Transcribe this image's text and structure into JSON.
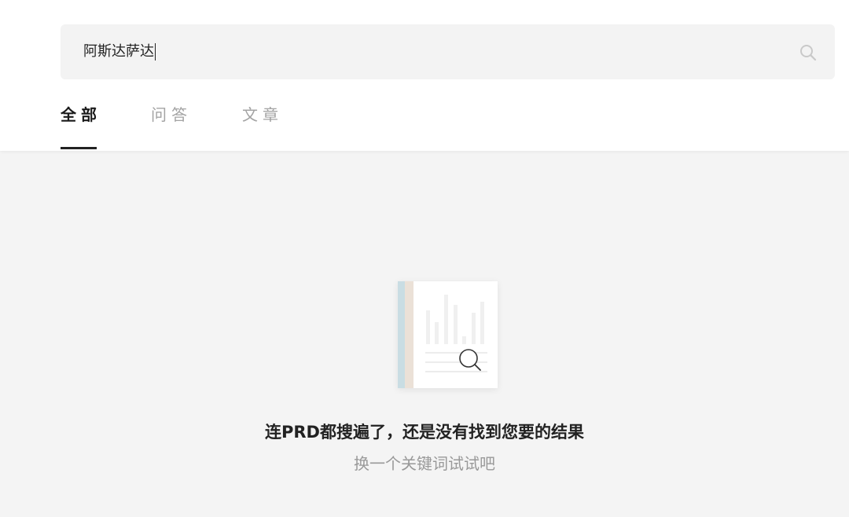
{
  "search": {
    "query": "阿斯达萨达",
    "icon": "search-icon"
  },
  "tabs": [
    {
      "label": "全部",
      "active": true
    },
    {
      "label": "问答",
      "active": false
    },
    {
      "label": "文章",
      "active": false
    }
  ],
  "empty_state": {
    "title": "连PRD都搜遍了，还是没有找到您要的结果",
    "subtitle": "换一个关键词试试吧",
    "icon": "no-results-document-icon"
  },
  "colors": {
    "page_background": "#f4f4f4",
    "header_background": "#ffffff",
    "search_background": "#f3f3f3",
    "active_tab": "#1a1a1a",
    "inactive_tab": "#a3a3a3"
  }
}
